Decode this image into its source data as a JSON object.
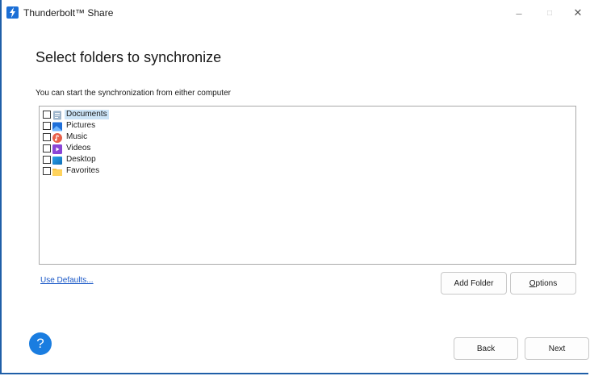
{
  "window": {
    "title": "Thunderbolt™ Share",
    "app_icon": "thunderbolt-icon",
    "controls": {
      "minimize": "–",
      "maximize": "□",
      "close": "✕"
    }
  },
  "page": {
    "heading": "Select folders to synchronize",
    "subtext": "You can start the synchronization from either computer"
  },
  "folders": [
    {
      "label": "Documents",
      "icon": "documents-folder-icon",
      "checked": false,
      "selected": true
    },
    {
      "label": "Pictures",
      "icon": "pictures-folder-icon",
      "checked": false,
      "selected": false
    },
    {
      "label": "Music",
      "icon": "music-folder-icon",
      "checked": false,
      "selected": false
    },
    {
      "label": "Videos",
      "icon": "videos-folder-icon",
      "checked": false,
      "selected": false
    },
    {
      "label": "Desktop",
      "icon": "desktop-folder-icon",
      "checked": false,
      "selected": false
    },
    {
      "label": "Favorites",
      "icon": "favorites-folder-icon",
      "checked": false,
      "selected": false
    }
  ],
  "actions": {
    "use_defaults": "Use Defaults...",
    "add_folder": "Add Folder",
    "options": "Options",
    "back": "Back",
    "next": "Next",
    "help": "?"
  },
  "colors": {
    "accent": "#1a7de0",
    "selection": "#cce4f7",
    "link": "#1a58c7"
  }
}
